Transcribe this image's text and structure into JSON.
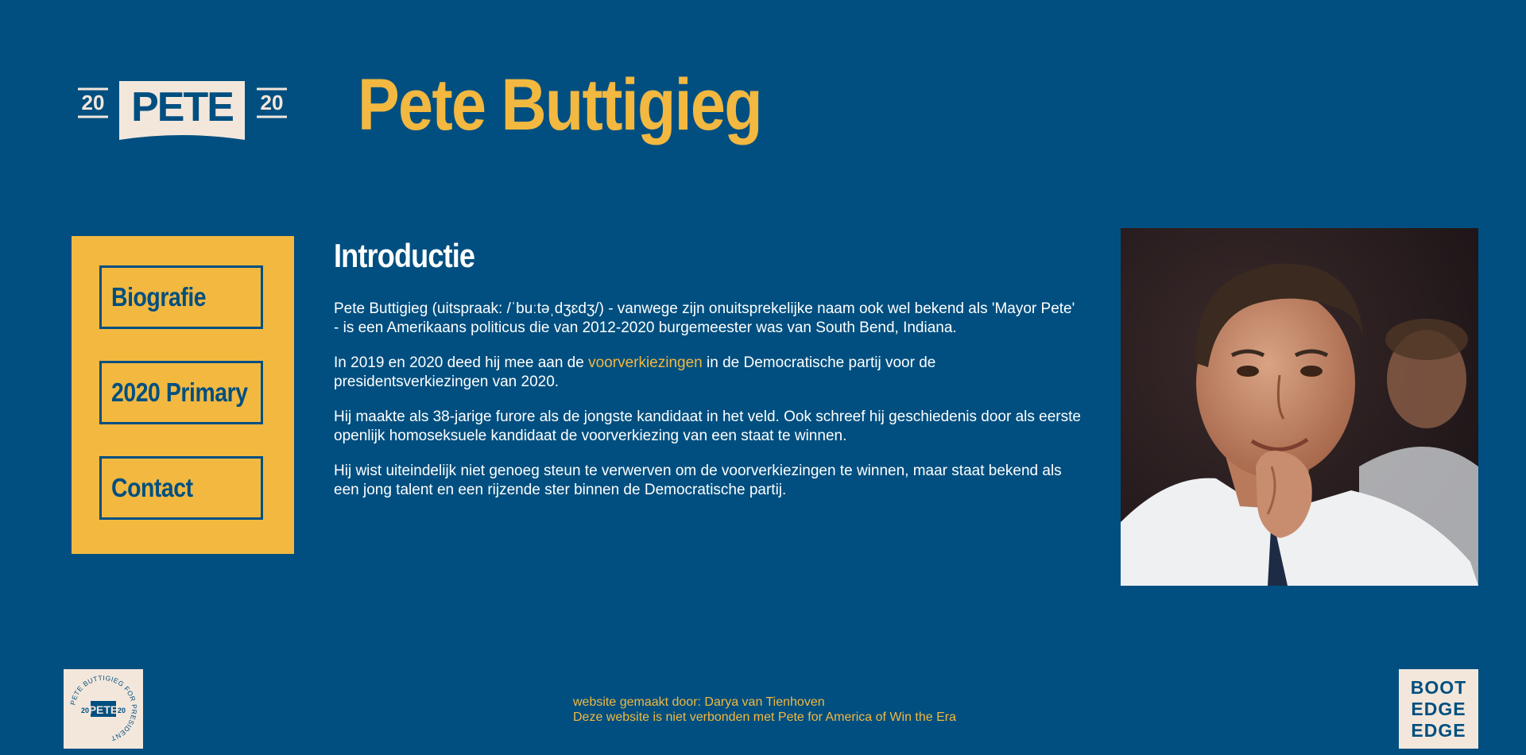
{
  "header": {
    "logo": {
      "left_year": "20",
      "name": "PETE",
      "right_year": "20"
    },
    "title": "Pete Buttigieg"
  },
  "nav": {
    "items": [
      {
        "label": "Biografie"
      },
      {
        "label": "2020 Primary"
      },
      {
        "label": "Contact"
      }
    ]
  },
  "main": {
    "heading": "Introductie",
    "paragraphs": [
      "Pete Buttigieg (uitspraak: /ˈbuːtəˌdʒɛdʒ/) - vanwege zijn onuitsprekelijke naam ook wel bekend als 'Mayor Pete' - is een Amerikaans politicus die van 2012-2020 burgemeester was van South Bend, Indiana.",
      {
        "before": "In 2019 en 2020 deed hij mee aan de ",
        "link": "voorverkiezingen",
        "after": " in de Democratische partij voor de presidentsverkiezingen van 2020."
      },
      "Hij maakte als 38-jarige furore als de jongste kandidaat in het veld. Ook schreef hij geschiedenis door als eerste openlijk homoseksuele kandidaat de voorverkiezing van een staat te winnen.",
      "Hij wist uiteindelijk niet genoeg steun te verwerven om de voorverkiezingen te winnen, maar staat bekend als een jong talent en een rijzende ster binnen de Democratische partij."
    ]
  },
  "footer": {
    "credit": "website gemaakt door: Darya van Tienhoven",
    "disclaimer": "Deze website is niet verbonden met Pete for America of Win the Era",
    "badge_left": {
      "ring_text": "PETE BUTTIGIEG FOR PRESIDENT",
      "year_left": "20",
      "name": "PETE",
      "year_right": "20"
    },
    "badge_right": [
      "BOOT",
      "EDGE",
      "EDGE"
    ]
  },
  "colors": {
    "background": "#004f80",
    "accent": "#f2b840",
    "cream": "#f3e7dc"
  }
}
